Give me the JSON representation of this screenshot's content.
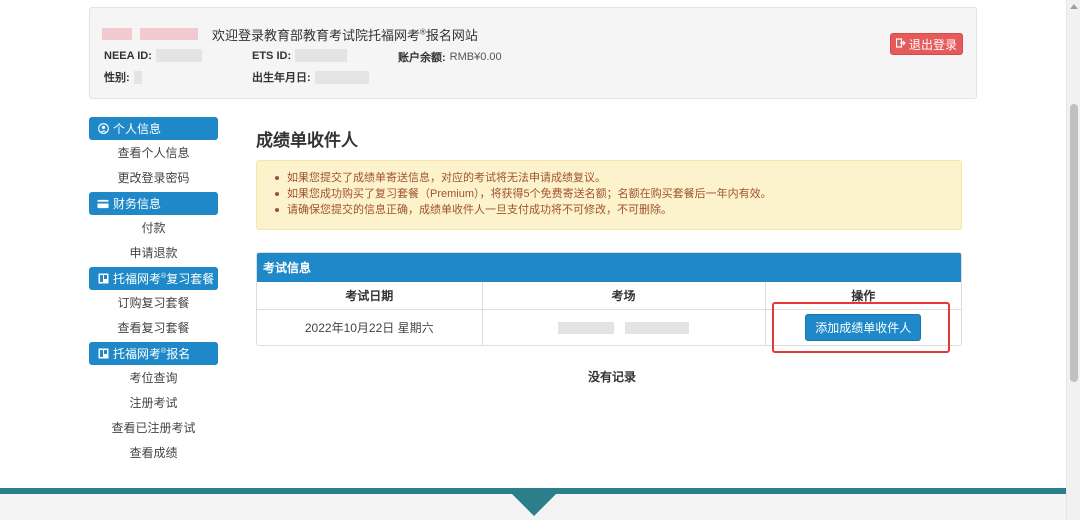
{
  "header": {
    "welcome": "欢迎登录教育部教育考试院托福网考",
    "welcome_sup": "®",
    "welcome_suffix": "报名网站",
    "neea_label": "NEEA ID:",
    "ets_label": "ETS ID:",
    "balance_label": "账户余额:",
    "balance_value": "RMB¥0.00",
    "gender_label": "性别:",
    "dob_label": "出生年月日:",
    "logout_label": "退出登录",
    "logout_icon": "sign-out-icon"
  },
  "sidebar": {
    "sections": [
      {
        "title": "个人信息",
        "icon": "user-circle-icon",
        "items": [
          "查看个人信息",
          "更改登录密码"
        ]
      },
      {
        "title": "财务信息",
        "icon": "credit-card-icon",
        "items": [
          "付款",
          "申请退款"
        ]
      },
      {
        "title": "托福网考",
        "title_sup": "®",
        "title_suffix": "复习套餐",
        "icon": "book-icon",
        "items": [
          "订购复习套餐",
          "查看复习套餐"
        ]
      },
      {
        "title": "托福网考",
        "title_sup": "®",
        "title_suffix": "报名",
        "icon": "book-icon",
        "items": [
          "考位查询",
          "注册考试",
          "查看已注册考试",
          "查看成绩"
        ]
      }
    ]
  },
  "main": {
    "title": "成绩单收件人",
    "alerts": [
      "如果您提交了成绩单寄送信息，对应的考试将无法申请成绩复议。",
      "如果您成功购买了复习套餐（Premium），将获得5个免费寄送名额；名额在购买套餐后一年内有效。",
      "请确保您提交的信息正确，成绩单收件人一旦支付成功将不可修改，不可删除。"
    ],
    "panel_title": "考试信息",
    "columns": [
      "考试日期",
      "考场",
      "操作"
    ],
    "row": {
      "date": "2022年10月22日 星期六",
      "action": "添加成绩单收件人"
    },
    "no_record": "没有记录"
  },
  "colors": {
    "accent": "#1e88c9",
    "danger": "#e55a5a",
    "warning_bg": "#fcf3cd",
    "footer": "#2b7f8a"
  }
}
